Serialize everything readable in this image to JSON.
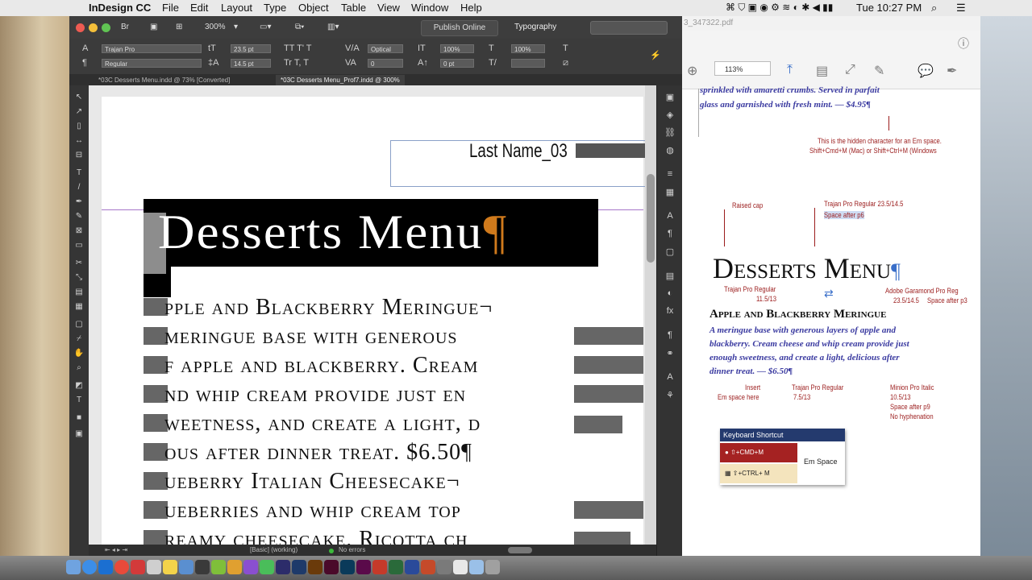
{
  "menubar": {
    "app_name": "InDesign CC",
    "menus": [
      "File",
      "Edit",
      "Layout",
      "Type",
      "Object",
      "Table",
      "View",
      "Window",
      "Help"
    ],
    "clock": "Tue 10:27 PM"
  },
  "indesign": {
    "zoom": "300%",
    "publish_online": "Publish Online",
    "workspace": "Typography",
    "font_family": "Trajan Pro",
    "font_style": "Regular",
    "font_size": "23.5 pt",
    "leading": "14.5 pt",
    "kerning": "Optical",
    "scale_h": "100%",
    "scale_v": "100%",
    "baseline_shift": "0 pt",
    "tracking": "0",
    "tabs": [
      "*03C Desserts Menu.indd @ 73% [Converted]",
      "*03C Desserts Menu_Prof7.indd @ 300%"
    ],
    "status_style": "[Basic] (working)",
    "status_errors": "No errors",
    "page": {
      "last_name": "Last Name_03",
      "title": "Desserts Menu",
      "pilcrow": "¶",
      "lines": [
        "pple and Blackberry Meringue¬",
        "meringue base with generous",
        "f apple and blackberry. Cream",
        "nd whip cream provide just en",
        "weetness, and create a light, d",
        "ous after dinner treat. $6.50¶",
        "ueberry Italian Cheesecake¬",
        "ueberries and whip cream top",
        "reamy cheesecake. Ricotta ch"
      ]
    }
  },
  "pdf": {
    "title_fragment": "3_347322.pdf",
    "zoom": "113%",
    "top_text_1": "sprinkled with amaretti crumbs. Served in parfait",
    "top_text_2": "glass and garnished with fresh mint. — $4.95¶",
    "hidden_note_1": "This is the hidden character for an Em space.",
    "hidden_note_2": "Shift+Cmd+M (Mac) or Shift+Ctrl+M (Windows",
    "raised_cap": "Raised cap",
    "trajan_title_1": "Trajan Pro Regular 23.5/14.5",
    "trajan_title_2": "Space after p6",
    "title": "Desserts Menu",
    "trajan_sub_1": "Trajan Pro Regular",
    "trajan_sub_2": "11.5/13",
    "garamond_1": "Adobe Garamond Pro Reg",
    "garamond_2": "23.5/14.5",
    "garamond_3": "Space after p3",
    "subhead": "Apple and Blackberry Meringue",
    "body": [
      "A meringue base with generous layers of apple and",
      "blackberry. Cream cheese and whip cream provide just",
      "enough sweetness, and create a light, delicious after",
      "dinner treat. — $6.50¶"
    ],
    "insert_1": "Insert",
    "insert_2": "Em space here",
    "trajan_price_1": "Trajan Pro Regular",
    "trajan_price_2": "7.5/13",
    "minion": [
      "Minion Pro Italic",
      "10.5/13",
      "Space after p9",
      "No hyphenation"
    ],
    "kbd_header": "Keyboard Shortcut",
    "kbd_mac": "⇧+CMD+M",
    "kbd_win": "⇧+CTRL+ M",
    "kbd_label": "Em Space"
  },
  "colors": {
    "accent": "#9b1c1c",
    "pdf_blue": "#3a3aa0",
    "pilcrow": "#d07a1c"
  }
}
